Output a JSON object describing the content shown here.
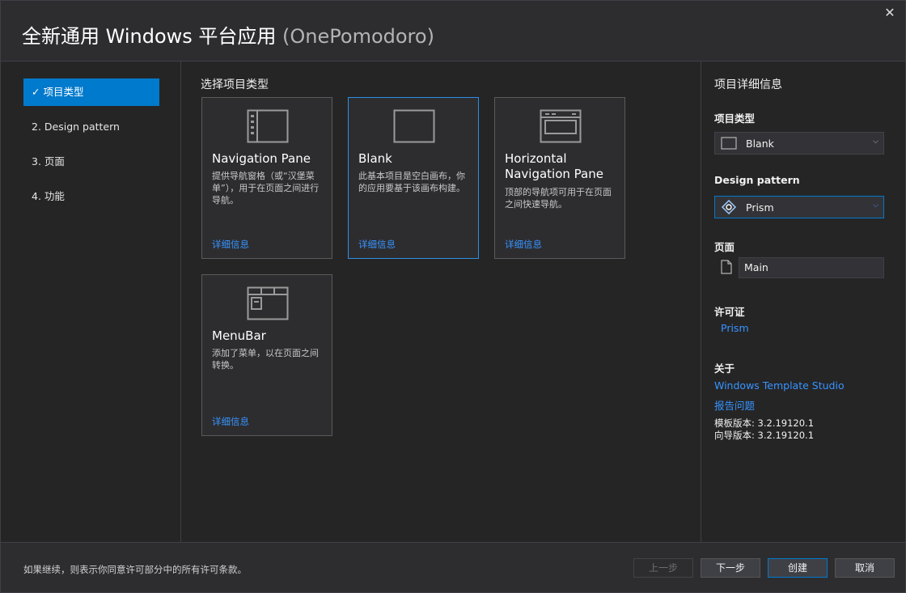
{
  "window": {
    "title": "全新通用 Windows 平台应用",
    "subtitle": "(OnePomodoro)"
  },
  "steps": [
    {
      "label": "✓ 项目类型",
      "active": true
    },
    {
      "label": "2.  Design pattern",
      "active": false
    },
    {
      "label": "3.  页面",
      "active": false
    },
    {
      "label": "4.  功能",
      "active": false
    }
  ],
  "main": {
    "heading": "选择项目类型",
    "cards": [
      {
        "icon": "navigation-pane-icon",
        "name": "Navigation Pane",
        "desc": "提供导航窗格（或“汉堡菜单”），用于在页面之间进行导航。",
        "link": "详细信息"
      },
      {
        "icon": "blank-icon",
        "name": "Blank",
        "desc": "此基本项目是空白画布，你的应用要基于该画布构建。",
        "link": "详细信息"
      },
      {
        "icon": "horizontal-navigation-icon",
        "name": "Horizontal Navigation Pane",
        "desc": "顶部的导航项可用于在页面之间快速导航。",
        "link": "详细信息"
      },
      {
        "icon": "menubar-icon",
        "name": "MenuBar",
        "desc": "添加了菜单，以在页面之间转换。",
        "link": "详细信息"
      }
    ]
  },
  "details": {
    "heading": "项目详细信息",
    "project_type_label": "项目类型",
    "project_type_value": "Blank",
    "design_pattern_label": "Design pattern",
    "design_pattern_value": "Prism",
    "pages_label": "页面",
    "page_name": "Main",
    "license_label": "许可证",
    "license_link": "Prism",
    "about_label": "关于",
    "about_link1": "Windows Template Studio",
    "about_link2": "报告问题",
    "template_version": "模板版本: 3.2.19120.1",
    "wizard_version": "向导版本: 3.2.19120.1"
  },
  "footer": {
    "notice": "如果继续，则表示你同意许可部分中的所有许可条款。",
    "prev": "上一步",
    "next": "下一步",
    "create": "创建",
    "cancel": "取消"
  }
}
